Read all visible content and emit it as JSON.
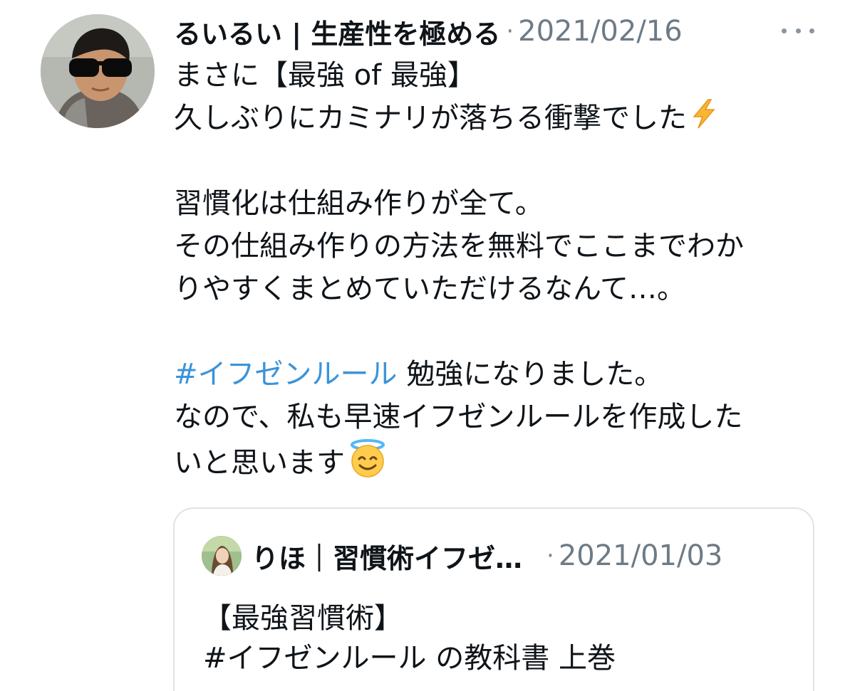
{
  "tweet": {
    "author_name": "るいるい | 生産性を極める",
    "separator": "·",
    "date": "2021/02/16",
    "lines": [
      "まさに【最強 of 最強】",
      "久しぶりにカミナリが落ちる衝撃でした",
      "",
      "習慣化は仕組み作りが全て。",
      "その仕組み作りの方法を無料でここまでわか",
      "りやすくまとめていただけるなんて…。",
      "",
      " 勉強になりました。",
      "なので、私も早速イフゼンルールを作成した",
      "いと思います"
    ],
    "hashtag": "#イフゼンルール",
    "icons": {
      "more": "more-horizontal-icon",
      "lightning": "high-voltage-emoji",
      "smile": "smiling-face-with-halo-emoji"
    }
  },
  "quoted_tweet": {
    "author_name": "りほ｜習慣術イフゼ…",
    "separator": "·",
    "date": "2021/01/03",
    "lines": [
      "【最強習慣術】",
      "#イフゼンルール の教科書 上巻"
    ]
  },
  "colors": {
    "hashtag": "#3b94d9",
    "secondary_text": "#6e7b86",
    "border": "#dfe3e7"
  }
}
